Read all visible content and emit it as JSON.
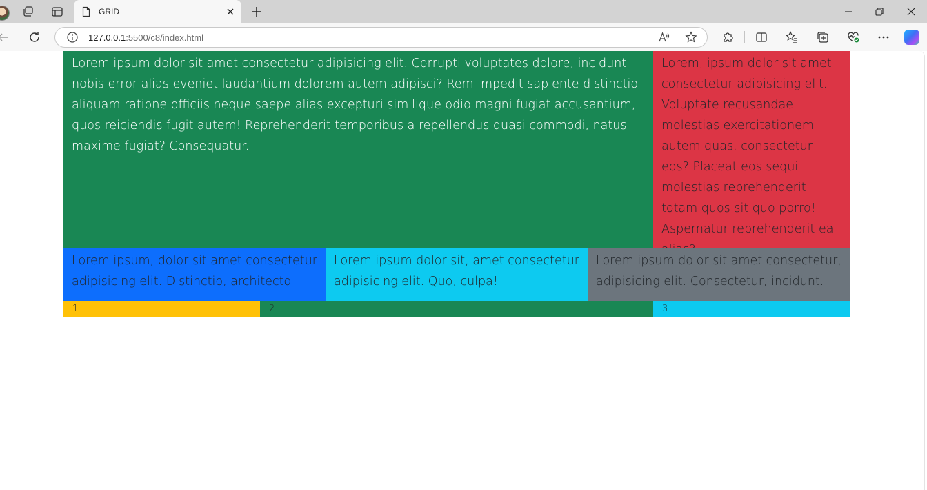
{
  "browser": {
    "tab_title": "GRID",
    "url_host": "127.0.0.1",
    "url_rest": ":5500/c8/index.html"
  },
  "page": {
    "main_text": "Lorem ipsum dolor sit amet consectetur adipisicing elit. Corrupti voluptates dolore, incidunt nobis error alias eveniet laudantium dolorem autem adipisci? Rem impedit sapiente distinctio aliquam ratione officiis neque saepe alias excepturi similique odio magni fugiat accusantium, quos reiciendis fugit autem! Reprehenderit temporibus a repellendus quasi commodi, natus maxime fugiat? Consequatur.",
    "side_text": "Lorem, ipsum dolor sit amet consectetur adipisicing elit. Voluptate recusandae molestias exercitationem autem quas, consectetur eos? Placeat eos sequi molestias reprehenderit totam quos sit quo porro! Aspernatur reprehenderit ea alias?",
    "row2": [
      "Lorem ipsum, dolor sit amet consectetur adipisicing elit. Distinctio, architecto",
      "Lorem ipsum dolor sit, amet consectetur adipisicing elit. Quo, culpa!",
      "Lorem ipsum dolor sit amet consectetur, adipisicing elit. Consectetur, incidunt."
    ],
    "row3": [
      "1",
      "2",
      "3"
    ]
  },
  "colors": {
    "green": "#198754",
    "red": "#dc3545",
    "blue": "#0d6efd",
    "cyan": "#0dcaf0",
    "gray": "#6c757d",
    "yellow": "#ffc107"
  },
  "icons": {
    "tab_actions": "workspaces-icon",
    "vertical_tabs": "tab-actions-icon",
    "page": "page-icon",
    "close": "close-icon",
    "new_tab": "plus-icon",
    "back": "back-arrow-icon",
    "reload": "reload-icon",
    "info": "info-icon",
    "read_aloud": "read-aloud-icon",
    "favorite": "star-icon",
    "extensions": "puzzle-icon",
    "split_screen": "split-screen-icon",
    "favorites": "favorites-icon",
    "collections": "collections-icon",
    "browser_essentials": "heart-pulse-icon",
    "more": "more-icon",
    "copilot": "copilot-icon"
  }
}
